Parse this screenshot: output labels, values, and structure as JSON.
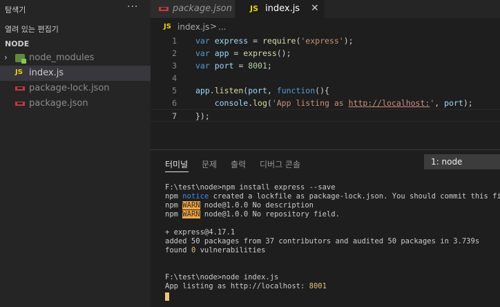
{
  "sidebar": {
    "title": "탐색기",
    "more": "···",
    "open_editors": "열려 있는 편집기",
    "folder": "NODE",
    "items": [
      {
        "label": "node_modules",
        "icon": "node-folder-icon",
        "type": "folder"
      },
      {
        "label": "index.js",
        "icon": "js-file-icon",
        "type": "file",
        "selected": true
      },
      {
        "label": "package-lock.json",
        "icon": "npm-file-icon",
        "type": "file"
      },
      {
        "label": "package.json",
        "icon": "npm-file-icon",
        "type": "file"
      }
    ]
  },
  "tabs": [
    {
      "label": "package.json",
      "icon": "npm-file-icon",
      "active": false
    },
    {
      "label": "index.js",
      "icon": "js-file-icon",
      "active": true,
      "js_mark": "JS",
      "close": "✕"
    }
  ],
  "breadcrumb": {
    "js_mark": "JS",
    "file": "index.js",
    "sep": ">",
    "more": "..."
  },
  "editor": {
    "line_numbers": [
      "1",
      "2",
      "3",
      "4",
      "5",
      "6",
      "7"
    ],
    "active_line": "6"
  },
  "panel": {
    "tabs": [
      "터미널",
      "문제",
      "출력",
      "디버그 콘솔"
    ],
    "active_tab": "터미널",
    "terminal_select": "1: node",
    "lines": [
      "F:\\test\\node>npm install express --save",
      "npm",
      "notice",
      "created a lockfile as package-lock.json. You should commit this file.",
      "WARN",
      "node@1.0.0 No description",
      "node@1.0.0 No repository field.",
      "+ express@4.17.1",
      "added 50 packages from 37 contributors and audited 50 packages in 3.739s",
      "found",
      "0",
      "vulnerabilities",
      "F:\\test\\node>node index.js",
      "App listing as http://localhost:",
      "8001"
    ]
  },
  "colors": {
    "accent_js": "#f0d000",
    "npm": "#cb3837",
    "warn_bg": "#f6a742"
  }
}
